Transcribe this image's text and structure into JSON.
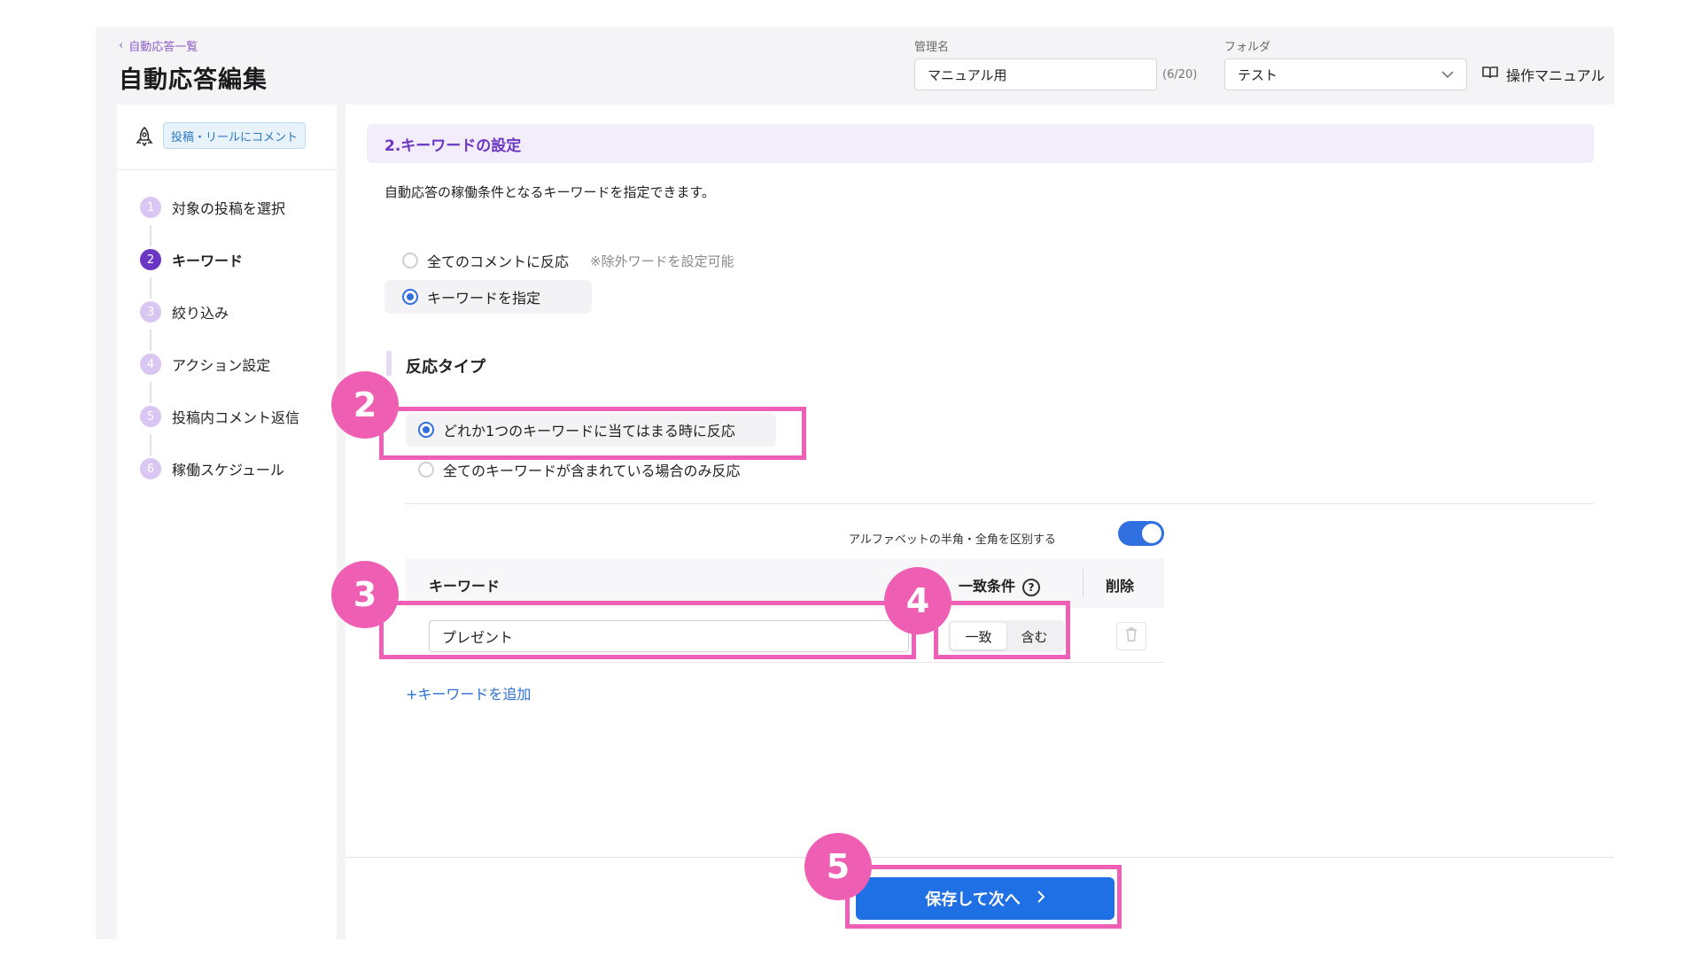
{
  "header": {
    "back_link": "自動応答一覧",
    "title": "自動応答編集",
    "name_label": "管理名",
    "name_value": "マニュアル用",
    "name_counter": "(6/20)",
    "folder_label": "フォルダ",
    "folder_value": "テスト",
    "manual_label": "操作マニュアル"
  },
  "sidebar": {
    "type_badge": "投稿・リールにコメント",
    "steps": [
      {
        "num": "1",
        "label": "対象の投稿を選択"
      },
      {
        "num": "2",
        "label": "キーワード"
      },
      {
        "num": "3",
        "label": "絞り込み"
      },
      {
        "num": "4",
        "label": "アクション設定"
      },
      {
        "num": "5",
        "label": "投稿内コメント返信"
      },
      {
        "num": "6",
        "label": "稼働スケジュール"
      }
    ]
  },
  "main": {
    "section_title": "2.キーワードの設定",
    "description": "自動応答の稼働条件となるキーワードを指定できます。",
    "scope_options": [
      {
        "label": "全てのコメントに反応",
        "note": "※除外ワードを設定可能",
        "checked": false
      },
      {
        "label": "キーワードを指定",
        "checked": true
      }
    ],
    "reaction_type_title": "反応タイプ",
    "reaction_options": [
      {
        "label": "どれか1つのキーワードに当てはまる時に反応",
        "checked": true
      },
      {
        "label": "全てのキーワードが含まれている場合のみ反応",
        "checked": false
      }
    ],
    "toggle_label": "アルファベットの半角・全角を区別する",
    "toggle_on": true,
    "table": {
      "col_keyword": "キーワード",
      "col_match": "一致条件",
      "col_delete": "削除",
      "rows": [
        {
          "keyword": "プレゼント",
          "match_options": [
            "一致",
            "含む"
          ],
          "selected": "一致"
        }
      ]
    },
    "add_keyword": "+キーワードを追加",
    "save_button": "保存して次へ"
  },
  "callouts": [
    "2",
    "3",
    "4",
    "5"
  ],
  "colors": {
    "accent_purple": "#6b36c4",
    "primary_blue": "#1f6fe5",
    "callout_pink": "#ef5fb6"
  }
}
